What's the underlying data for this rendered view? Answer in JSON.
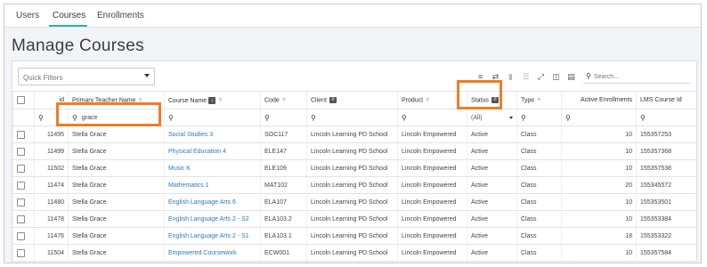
{
  "tabs": [
    {
      "label": "Users"
    },
    {
      "label": "Courses"
    },
    {
      "label": "Enrollments"
    }
  ],
  "page_title": "Manage Courses",
  "quick_filters": {
    "placeholder": "Quick Filters"
  },
  "search": {
    "placeholder": "Search..."
  },
  "columns": [
    {
      "label": ""
    },
    {
      "label": "id"
    },
    {
      "label": "Primary Teacher Name"
    },
    {
      "label": "Course Name"
    },
    {
      "label": "Code"
    },
    {
      "label": "Client"
    },
    {
      "label": "Product"
    },
    {
      "label": "Status"
    },
    {
      "label": "Type"
    },
    {
      "label": "Active Enrollments"
    },
    {
      "label": "LMS Course Id"
    }
  ],
  "filters": {
    "teacher_value": "grace",
    "status_value": "(All)"
  },
  "rows": [
    {
      "id": "11495",
      "teacher": "Stella Grace",
      "course": "Social Studies 3",
      "code": "SOC117",
      "client": "Lincoln Learning PD School",
      "product": "Lincoln Empowered",
      "status": "Active",
      "type": "Class",
      "enrollments": "10",
      "lms": "155357253"
    },
    {
      "id": "11499",
      "teacher": "Stella Grace",
      "course": "Physical Education 4",
      "code": "ELE147",
      "client": "Lincoln Learning PD School",
      "product": "Lincoln Empowered",
      "status": "Active",
      "type": "Class",
      "enrollments": "10",
      "lms": "155357368"
    },
    {
      "id": "11502",
      "teacher": "Stella Grace",
      "course": "Music K",
      "code": "ELE109",
      "client": "Lincoln Learning PD School",
      "product": "Lincoln Empowered",
      "status": "Active",
      "type": "Class",
      "enrollments": "10",
      "lms": "155357538"
    },
    {
      "id": "11474",
      "teacher": "Stella Grace",
      "course": "Mathematics 1",
      "code": "MAT102",
      "client": "Lincoln Learning PD School",
      "product": "Lincoln Empowered",
      "status": "Active",
      "type": "Class",
      "enrollments": "20",
      "lms": "155345572"
    },
    {
      "id": "11480",
      "teacher": "Stella Grace",
      "course": "English Language Arts 6",
      "code": "ELA107",
      "client": "Lincoln Learning PD School",
      "product": "Lincoln Empowered",
      "status": "Active",
      "type": "Class",
      "enrollments": "10",
      "lms": "155353501"
    },
    {
      "id": "11478",
      "teacher": "Stella Grace",
      "course": "English Language Arts 2 - S2",
      "code": "ELA103.2",
      "client": "Lincoln Learning PD School",
      "product": "Lincoln Empowered",
      "status": "Active",
      "type": "Class",
      "enrollments": "10",
      "lms": "155353384"
    },
    {
      "id": "11476",
      "teacher": "Stella Grace",
      "course": "English Language Arts 2 - S1",
      "code": "ELA103.1",
      "client": "Lincoln Learning PD School",
      "product": "Lincoln Empowered",
      "status": "Active",
      "type": "Class",
      "enrollments": "18",
      "lms": "155353322"
    },
    {
      "id": "11504",
      "teacher": "Stella Grace",
      "course": "Empowered Coursework",
      "code": "ECW001",
      "client": "Lincoln Learning PD School",
      "product": "Lincoln Empowered",
      "status": "Active",
      "type": "Class",
      "enrollments": "10",
      "lms": "155357584"
    }
  ],
  "colors": {
    "accent": "#2ab0b8",
    "highlight": "#ef7d22",
    "link": "#2f79bf"
  },
  "icons": [
    "filter-icon",
    "swap-icon",
    "delete-icon",
    "columns-icon",
    "expand-icon",
    "export-icon",
    "print-icon",
    "search-icon"
  ]
}
